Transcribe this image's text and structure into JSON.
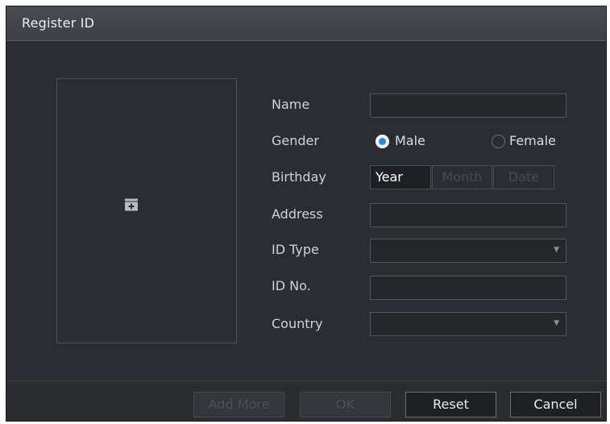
{
  "dialog": {
    "title": "Register ID"
  },
  "photo": {
    "add_icon": "add-photo-icon"
  },
  "form": {
    "name": {
      "label": "Name",
      "value": ""
    },
    "gender": {
      "label": "Gender",
      "options": [
        {
          "label": "Male",
          "selected": true
        },
        {
          "label": "Female",
          "selected": false
        }
      ]
    },
    "birthday": {
      "label": "Birthday",
      "year": "Year",
      "month": "Month",
      "date": "Date"
    },
    "address": {
      "label": "Address",
      "value": ""
    },
    "id_type": {
      "label": "ID Type",
      "value": "",
      "icon": "dropdown-arrow-icon"
    },
    "id_no": {
      "label": "ID No.",
      "value": ""
    },
    "country": {
      "label": "Country",
      "value": "",
      "icon": "dropdown-arrow-icon"
    }
  },
  "footer": {
    "add_more": "Add More",
    "ok": "OK",
    "reset": "Reset",
    "cancel": "Cancel"
  },
  "colors": {
    "accent": "#1a8cff",
    "panel": "#2b2d32",
    "titlebar": "#3d4046"
  }
}
